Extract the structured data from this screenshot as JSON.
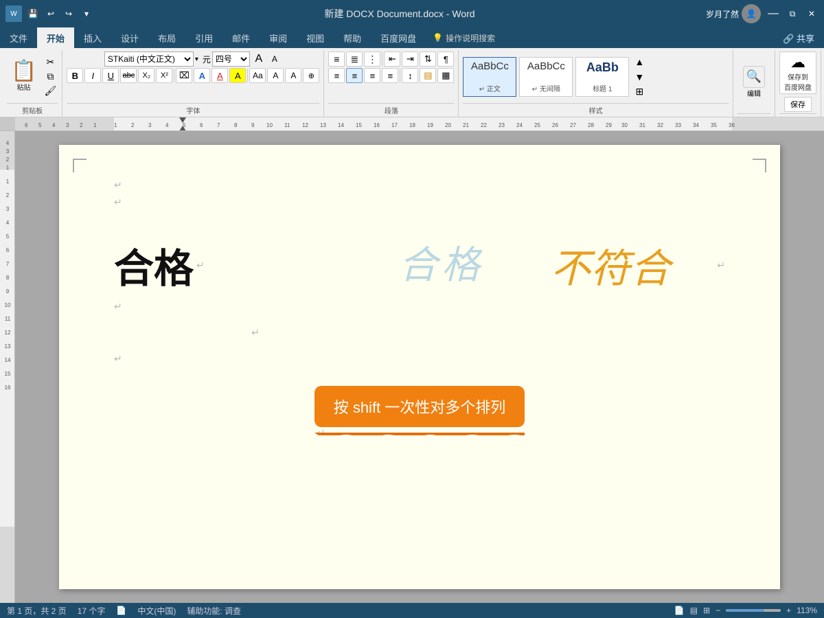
{
  "titlebar": {
    "title": "新建 DOCX Document.docx - Word",
    "user": "岁月了然",
    "quick_save": "💾",
    "undo": "↩",
    "redo": "↪",
    "minimize": "🗕",
    "restore": "🗗",
    "close": "✕"
  },
  "ribbon": {
    "tabs": [
      "文件",
      "开始",
      "插入",
      "设计",
      "布局",
      "引用",
      "邮件",
      "审阅",
      "视图",
      "帮助",
      "百度网盘",
      "操作说明搜索",
      "共享"
    ],
    "active_tab": "开始",
    "groups": {
      "clipboard": {
        "label": "剪贴板",
        "paste": "粘贴",
        "cut": "✂",
        "copy": "⧉",
        "format_paint": "🖌"
      },
      "font": {
        "label": "字体",
        "font_name": "STKaiti (中文正文)",
        "font_size": "四号",
        "bold": "B",
        "italic": "I",
        "underline": "U",
        "strikethrough": "abc",
        "subscript": "X₂",
        "superscript": "X²"
      },
      "paragraph": {
        "label": "段落"
      },
      "styles": {
        "label": "样式",
        "items": [
          {
            "name": "正文",
            "preview": "AaBbCc",
            "active": true
          },
          {
            "name": "无间隔",
            "preview": "AaBbCc"
          },
          {
            "name": "标题 1",
            "preview": "AaBb"
          }
        ]
      },
      "editing": {
        "label": "编辑",
        "search_icon": "🔍"
      },
      "save": {
        "label": "保存",
        "save_to_baidu": "保存到\n百度网盘",
        "save": "保存"
      }
    }
  },
  "ruler": {
    "marks": [
      "6",
      "5",
      "4",
      "3",
      "2",
      "1",
      "1",
      "2",
      "3",
      "4",
      "5",
      "6",
      "7",
      "8",
      "9",
      "10",
      "11",
      "12",
      "13",
      "14",
      "15",
      "16",
      "17",
      "18",
      "19",
      "20",
      "21",
      "22",
      "23",
      "24",
      "25",
      "26",
      "27",
      "28",
      "29",
      "30",
      "31",
      "32",
      "33",
      "34",
      "35",
      "36"
    ]
  },
  "left_ruler": {
    "marks": [
      "4",
      "3",
      "2",
      "1",
      "1",
      "2",
      "3",
      "4",
      "5",
      "6",
      "7",
      "8",
      "9",
      "10",
      "11",
      "12",
      "13",
      "14",
      "15",
      "16"
    ]
  },
  "document": {
    "content": {
      "stamp_text": "合格",
      "stamp_color": "rgba(100,170,210,0.45)",
      "text_hege_large": "合格",
      "text_bufu": "不符合",
      "callout_text": "按 shift 一次性对多个排列",
      "paragraph_marks": [
        "↵",
        "↵",
        "↵",
        "↵",
        "↵",
        "↵",
        "↵"
      ]
    }
  },
  "statusbar": {
    "page_info": "第 1 页，共 2 页",
    "word_count": "17 个字",
    "lang": "中文(中国)",
    "accessibility": "辅助功能: 调查",
    "zoom_level": "113%",
    "page_icon": "📄"
  }
}
